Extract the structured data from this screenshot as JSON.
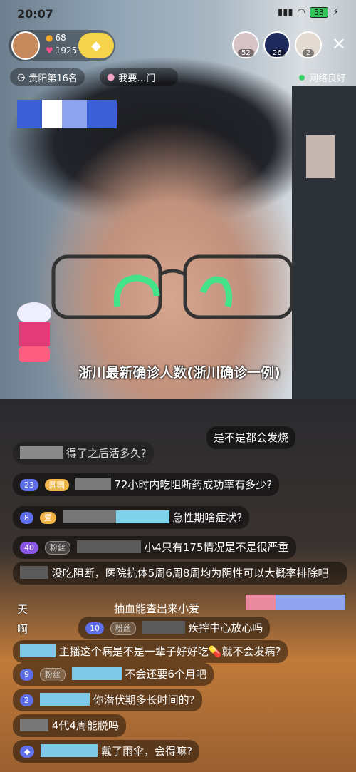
{
  "status_bar": {
    "time": "20:07",
    "battery": "53"
  },
  "host": {
    "likes": "68",
    "followers": "1925"
  },
  "viewers": [
    {
      "count": "52"
    },
    {
      "count": "26"
    },
    {
      "count": "2"
    }
  ],
  "rank_pill": "贵阳第16名",
  "wish_pill": "我要…门",
  "network": "网络良好",
  "headline": "浙川最新确诊人数(浙川确诊一例)",
  "comments": [
    {
      "text": "是不是都会发烧"
    },
    {
      "text": "得了之后活多久?"
    },
    {
      "level": "23",
      "fan": "圆圆",
      "text": "72小时内吃阻断药成功率有多少?"
    },
    {
      "level": "8",
      "fan": "爱",
      "text": "急性期啥症状?"
    },
    {
      "level": "40",
      "fan": "粉丝",
      "text": "小4只有175情况是不是很严重"
    },
    {
      "text": "没吃阻断，医院抗体5周6周8周均为阴性可以大概率排除吧"
    },
    {
      "text": "抽血能查出来小爱"
    },
    {
      "level": "10",
      "fan": "粉丝",
      "text": "疾控中心放心吗"
    },
    {
      "text": "主播这个病是不是一辈子好好吃💊就不会发病?"
    },
    {
      "level": "9",
      "fan": "粉丝",
      "text": "不会还要6个月吧"
    },
    {
      "level": "2",
      "text": "你潜伏期多长时间的?"
    },
    {
      "text": "4代4周能脱吗"
    },
    {
      "text": "戴了雨伞，会得嘛?"
    }
  ],
  "overlap_labels": {
    "tian": "天",
    "a": "啊"
  }
}
